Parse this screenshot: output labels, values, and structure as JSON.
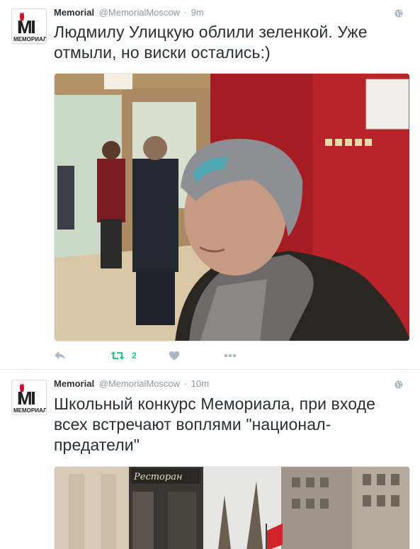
{
  "tweets": [
    {
      "name": "Memorial",
      "handle": "@MemorialMoscow",
      "separator": "·",
      "time": "9m",
      "text": "Людмилу Улицкую облили зеленкой. Уже отмыли, но виски остались:)",
      "avatar_text": "МЕМОРИАЛ",
      "avatar_letter": "M",
      "actions": {
        "retweet_count": "2"
      },
      "icons": [
        "globe-icon",
        "reply-icon",
        "retweet-icon",
        "heart-icon",
        "more-icon"
      ]
    },
    {
      "name": "Memorial",
      "handle": "@MemorialMoscow",
      "separator": "·",
      "time": "10m",
      "text": "Школьный конкурс Мемориала, при входе всех встречают воплями \"национал-предатели\"",
      "avatar_text": "МЕМОРИАЛ",
      "avatar_letter": "M",
      "media_sign": "Ресторан",
      "icons": [
        "globe-icon"
      ]
    }
  ],
  "colors": {
    "text": "#292f33",
    "meta": "#8899a6",
    "action_icon": "#aab8c2",
    "retweet": "#19cf86",
    "logo_red": "#c8102e",
    "border": "#e1e8ed"
  }
}
